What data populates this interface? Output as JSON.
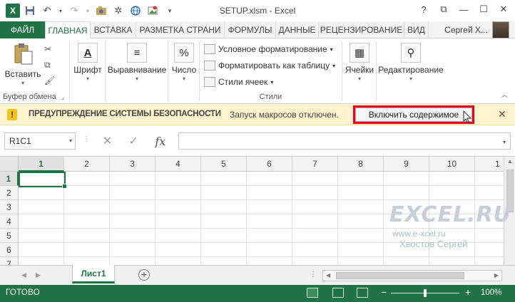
{
  "window": {
    "title": "SETUP.xlsm - Excel",
    "app_icon": "X",
    "controls": [
      "?",
      "⧉",
      "—",
      "☐",
      "✕"
    ]
  },
  "qat": {
    "icons": [
      "save-icon",
      "undo-icon",
      "redo-icon",
      "camera-icon",
      "sparkle-icon",
      "globe-icon",
      "image-icon",
      "customize-icon"
    ]
  },
  "tabs": {
    "file": "ФАЙЛ",
    "items": [
      "ГЛАВНАЯ",
      "ВСТАВКА",
      "РАЗМЕТКА СТРАНИ",
      "ФОРМУЛЫ",
      "ДАННЫЕ",
      "РЕЦЕНЗИРОВАНИЕ",
      "ВИД"
    ],
    "active_index": 0,
    "user_name": "Сергей Х..."
  },
  "ribbon": {
    "clipboard": {
      "paste_label": "Вставить",
      "group_label": "Буфер обмена"
    },
    "font_label": "Шрифт",
    "alignment_label": "Выравнивание",
    "number_label": "Число",
    "styles": {
      "conditional_formatting": "Условное форматирование",
      "format_as_table": "Форматировать как таблицу",
      "cell_styles": "Стили ячеек",
      "group_label": "Стили"
    },
    "cells_label": "Ячейки",
    "editing_label": "Редактирование"
  },
  "security_bar": {
    "title": "ПРЕДУПРЕЖДЕНИЕ СИСТЕМЫ БЕЗОПАСНОСТИ",
    "message": "Запуск макросов отключен.",
    "enable_button": "Включить содержимое",
    "icon": "!"
  },
  "formula_bar": {
    "name_box": "R1C1",
    "formula": "",
    "fx_label": "fx"
  },
  "grid": {
    "columns": [
      "1",
      "2",
      "3",
      "4",
      "5",
      "6",
      "7",
      "8",
      "9",
      "10",
      "1"
    ],
    "rows": [
      "1",
      "2",
      "3",
      "4",
      "5",
      "6",
      "7"
    ],
    "selected_column": "1",
    "selected_row": "1"
  },
  "watermark": {
    "logo": "EXCEL.RU",
    "site": "www.e-xcel.ru",
    "author": "Хвостов Сергей"
  },
  "sheets": {
    "tabs": [
      "Лист1"
    ],
    "active": "Лист1",
    "add_label": "+"
  },
  "status": {
    "ready": "ГОТОВО",
    "zoom_minus": "−",
    "zoom_plus": "+",
    "zoom_level": "100%"
  },
  "colors": {
    "excel_green": "#217346",
    "security_yellow": "#fff4ce",
    "highlight_red": "#e8001c"
  }
}
